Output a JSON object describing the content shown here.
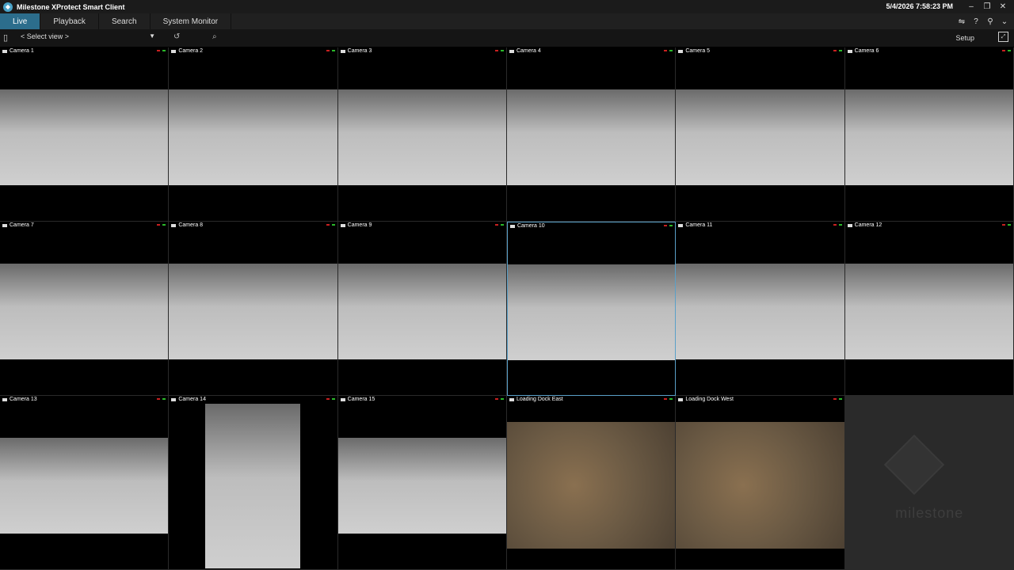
{
  "window": {
    "title": "Milestone XProtect Smart Client",
    "clock": "5/4/2026 7:58:23 PM",
    "controls": [
      "–",
      "❐",
      "✕"
    ]
  },
  "tabs": [
    {
      "label": "Live",
      "active": true
    },
    {
      "label": "Playback",
      "active": false
    },
    {
      "label": "Search",
      "active": false
    },
    {
      "label": "System Monitor",
      "active": false
    }
  ],
  "toolbar": {
    "view_select": "< Select view >",
    "setup_label": "Setup"
  },
  "cameras": [
    {
      "name": "Camera 1"
    },
    {
      "name": "Camera 2"
    },
    {
      "name": "Camera 3"
    },
    {
      "name": "Camera 4"
    },
    {
      "name": "Camera 5"
    },
    {
      "name": "Camera 6"
    },
    {
      "name": "Camera 7"
    },
    {
      "name": "Camera 8"
    },
    {
      "name": "Camera 9"
    },
    {
      "name": "Camera 10",
      "selected": true
    },
    {
      "name": "Camera 11"
    },
    {
      "name": "Camera 12"
    },
    {
      "name": "Camera 13"
    },
    {
      "name": "Camera 14"
    },
    {
      "name": "Camera 15"
    },
    {
      "name": "Loading Dock East"
    },
    {
      "name": "Loading Dock West"
    }
  ],
  "empty_slot": {
    "logo_text": "milestone"
  },
  "colors": {
    "accent": "#2c6d8c",
    "selection": "#5aa0c8",
    "recording": "#c82020",
    "live": "#2ab82a"
  }
}
